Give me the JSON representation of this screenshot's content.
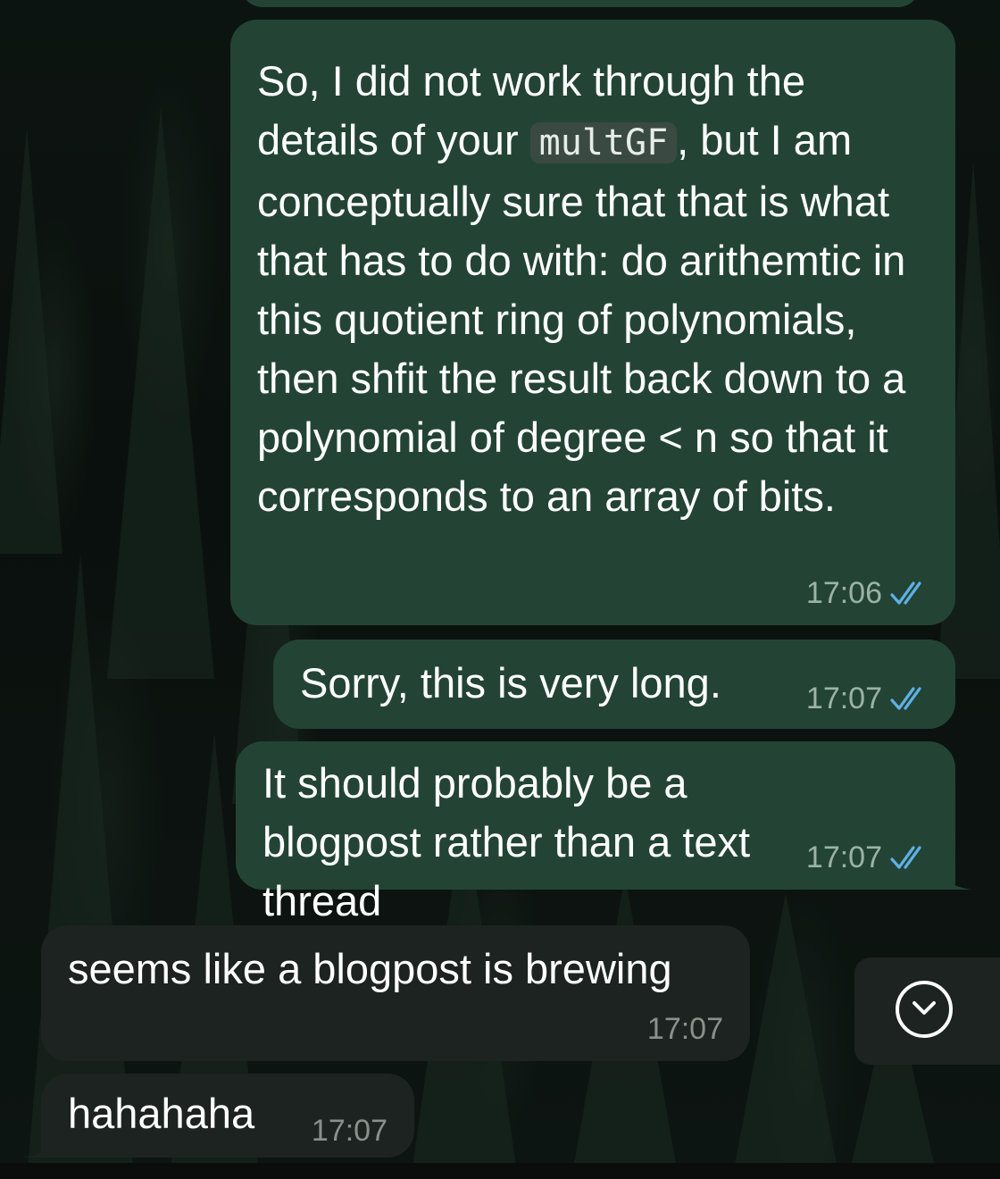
{
  "messages": [
    {
      "direction": "outgoing",
      "text_before": "So, I did not work through the details of your ",
      "code": "multGF",
      "text_after": ", but I am conceptually sure that that is what that has to do with: do arithemtic in this quotient ring of polynomials, then shfit the result back down to a polynomial of degree < n so that it corresponds to an array of bits.",
      "time": "17:06",
      "status": "read"
    },
    {
      "direction": "outgoing",
      "text": "Sorry, this is very long.",
      "time": "17:07",
      "status": "read"
    },
    {
      "direction": "outgoing",
      "text": "It should probably be a blogpost rather than a text thread",
      "time": "17:07",
      "status": "read"
    },
    {
      "direction": "incoming",
      "text": "seems like a blogpost is brewing",
      "time": "17:07"
    },
    {
      "direction": "incoming",
      "text": "hahahaha",
      "time": "17:07"
    }
  ],
  "icons": {
    "read_receipt": "double-check-icon",
    "scroll_down": "chevron-down-circle-icon"
  },
  "colors": {
    "outgoing_bubble": "#234434",
    "incoming_bubble": "#1d2320",
    "read_tick": "#5fb0e6"
  }
}
